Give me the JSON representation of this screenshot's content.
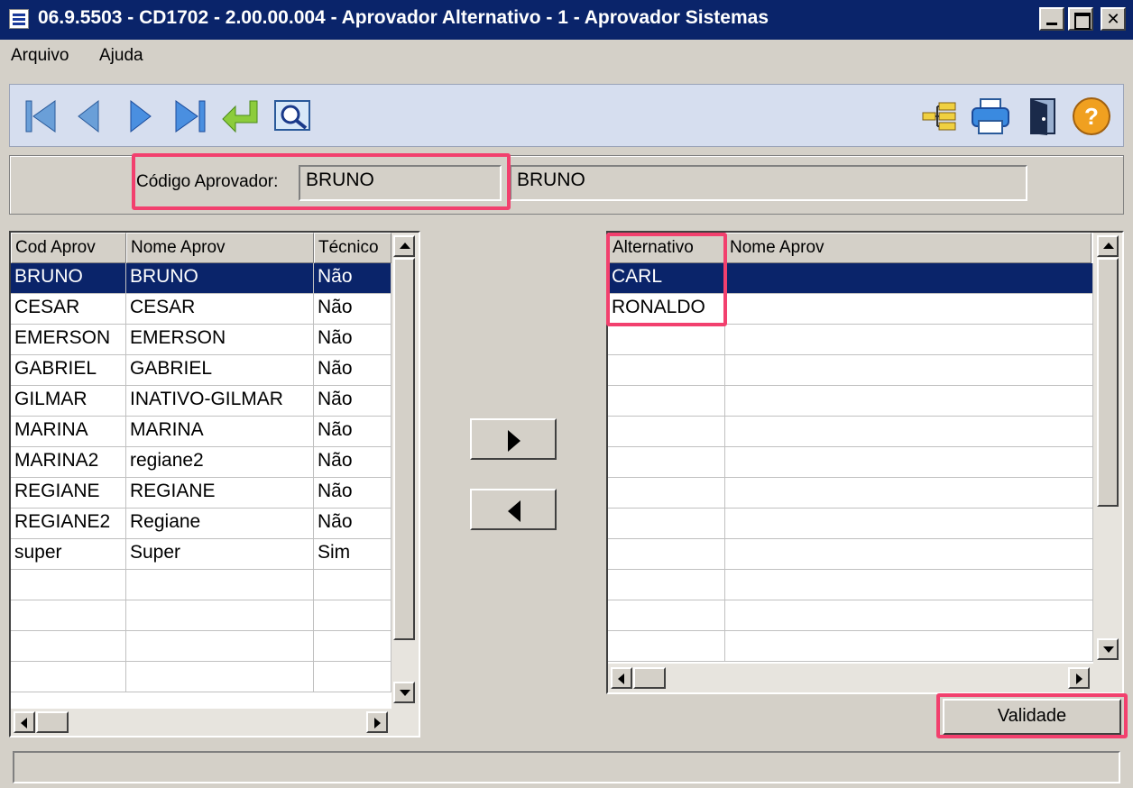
{
  "window": {
    "title": "06.9.5503 - CD1702 - 2.00.00.004 - Aprovador Alternativo - 1 - Aprovador Sistemas"
  },
  "menu": {
    "items": [
      "Arquivo",
      "Ajuda"
    ]
  },
  "toolbar": {
    "left_icons": [
      "first-record-icon",
      "previous-record-icon",
      "next-record-icon",
      "last-record-icon",
      "return-icon",
      "search-icon"
    ],
    "right_icons": [
      "tree-structure-icon",
      "printer-icon",
      "exit-door-icon",
      "help-icon"
    ]
  },
  "header": {
    "code_label": "Código Aprovador:",
    "code_value": "BRUNO",
    "name_value": "BRUNO"
  },
  "left_grid": {
    "columns": [
      "Cod Aprov",
      "Nome Aprov",
      "Técnico"
    ],
    "rows": [
      [
        "BRUNO",
        "BRUNO",
        "Não"
      ],
      [
        "CESAR",
        "CESAR",
        "Não"
      ],
      [
        "EMERSON",
        "EMERSON",
        "Não"
      ],
      [
        "GABRIEL",
        "GABRIEL",
        "Não"
      ],
      [
        "GILMAR",
        "INATIVO-GILMAR",
        "Não"
      ],
      [
        "MARINA",
        "MARINA",
        "Não"
      ],
      [
        "MARINA2",
        "regiane2",
        "Não"
      ],
      [
        "REGIANE",
        "REGIANE",
        "Não"
      ],
      [
        "REGIANE2",
        "Regiane",
        "Não"
      ],
      [
        "super",
        "Super",
        "Sim"
      ]
    ],
    "selected_index": 0
  },
  "right_grid": {
    "columns": [
      "Alternativo",
      "Nome Aprov"
    ],
    "rows": [
      [
        "CARL",
        ""
      ],
      [
        "RONALDO",
        ""
      ]
    ],
    "selected_index": 0
  },
  "buttons": {
    "validade_label": "Validade"
  },
  "colors": {
    "highlight": "#f2406e",
    "selection": "#0a246a",
    "title_bar": "#0a246a"
  }
}
